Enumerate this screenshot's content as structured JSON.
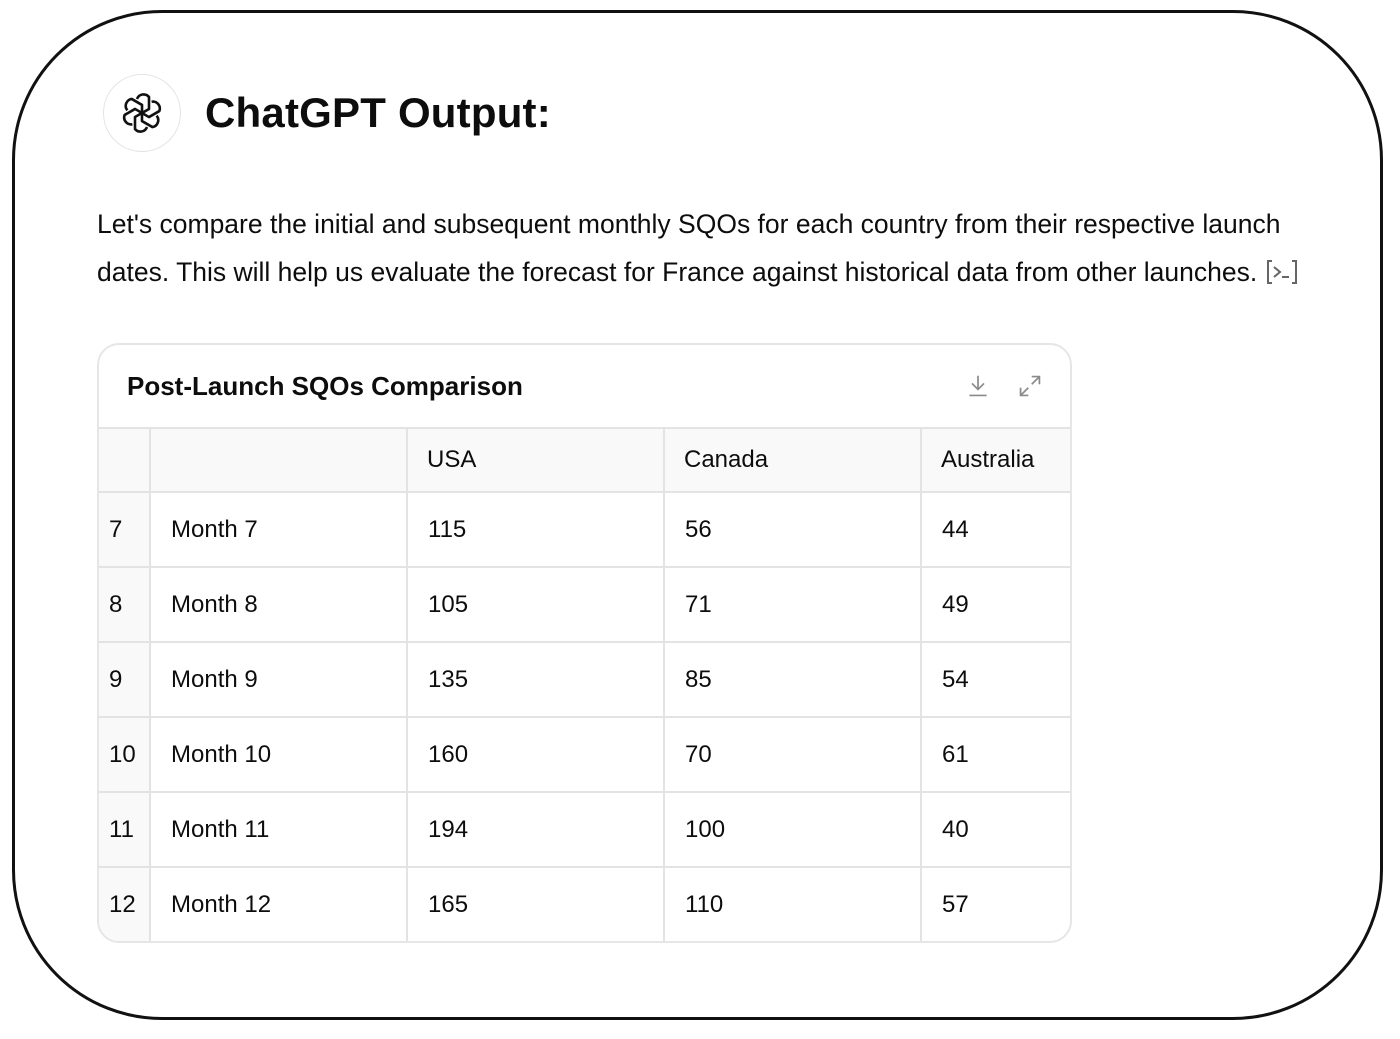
{
  "header": {
    "title": "ChatGPT Output:",
    "avatar_icon": "openai-logo-icon"
  },
  "message": {
    "text": "Let's compare the initial and subsequent monthly SQOs for each country from their respective launch dates. This will help us evaluate the forecast for France against historical data from other launches.",
    "code_icon": "code-interpreter-icon"
  },
  "table": {
    "title": "Post-Launch SQOs Comparison",
    "download_icon": "download-icon",
    "expand_icon": "expand-icon",
    "columns": [
      "",
      "",
      "USA",
      "Canada",
      "Australia"
    ],
    "rows": [
      [
        "7",
        "Month 7",
        "115",
        "56",
        "44"
      ],
      [
        "8",
        "Month 8",
        "105",
        "71",
        "49"
      ],
      [
        "9",
        "Month 9",
        "135",
        "85",
        "54"
      ],
      [
        "10",
        "Month 10",
        "160",
        "70",
        "61"
      ],
      [
        "11",
        "Month 11",
        "194",
        "100",
        "40"
      ],
      [
        "12",
        "Month 12",
        "165",
        "110",
        "57"
      ]
    ]
  }
}
